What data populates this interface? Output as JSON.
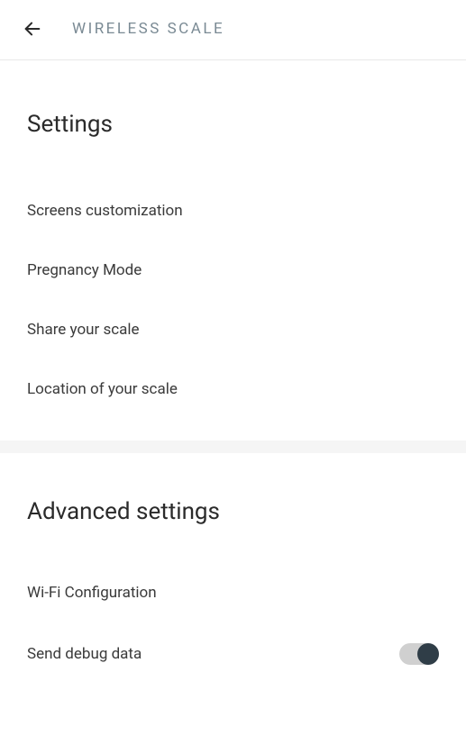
{
  "header": {
    "title": "WIRELESS SCALE"
  },
  "settings": {
    "title": "Settings",
    "items": [
      {
        "label": "Screens customization"
      },
      {
        "label": "Pregnancy Mode"
      },
      {
        "label": "Share your scale"
      },
      {
        "label": "Location of your scale"
      }
    ]
  },
  "advanced": {
    "title": "Advanced settings",
    "items": [
      {
        "label": "Wi-Fi Configuration"
      },
      {
        "label": "Send debug data",
        "toggle": true
      }
    ]
  }
}
